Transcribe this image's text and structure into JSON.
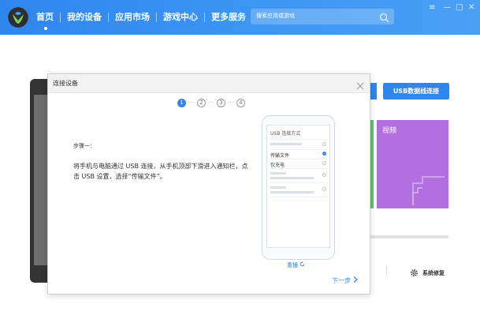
{
  "nav": {
    "items": [
      "首页",
      "我的设备",
      "应用市场",
      "游戏中心",
      "更多服务"
    ],
    "active_index": 0
  },
  "search": {
    "placeholder": "搜索应用或游戏"
  },
  "window_controls": {
    "menu": "≡",
    "minimize": "—",
    "maximize": "□",
    "close": "✕"
  },
  "background": {
    "usb_button": "USB数据线连接",
    "video_tile_label": "视频",
    "repair_label": "系统修复"
  },
  "modal": {
    "title": "连接设备",
    "steps": [
      "1",
      "2",
      "3",
      "4"
    ],
    "active_step": 1,
    "step_heading": "步骤一：",
    "instruction": "将手机与电脑通过 USB 连接，从手机顶部下滑进入通知栏，点击 USB 设置，选择“传输文件”。",
    "phone": {
      "screen_title": "USB 连接方式",
      "options": [
        "传输文件",
        "仅充电"
      ],
      "selected_option": "传输文件"
    },
    "redo_label": "重播",
    "next_label": "下一步"
  },
  "colors": {
    "accent": "#2f86ee",
    "video_tile": "#b36fe0",
    "green_tile": "#65c466"
  }
}
